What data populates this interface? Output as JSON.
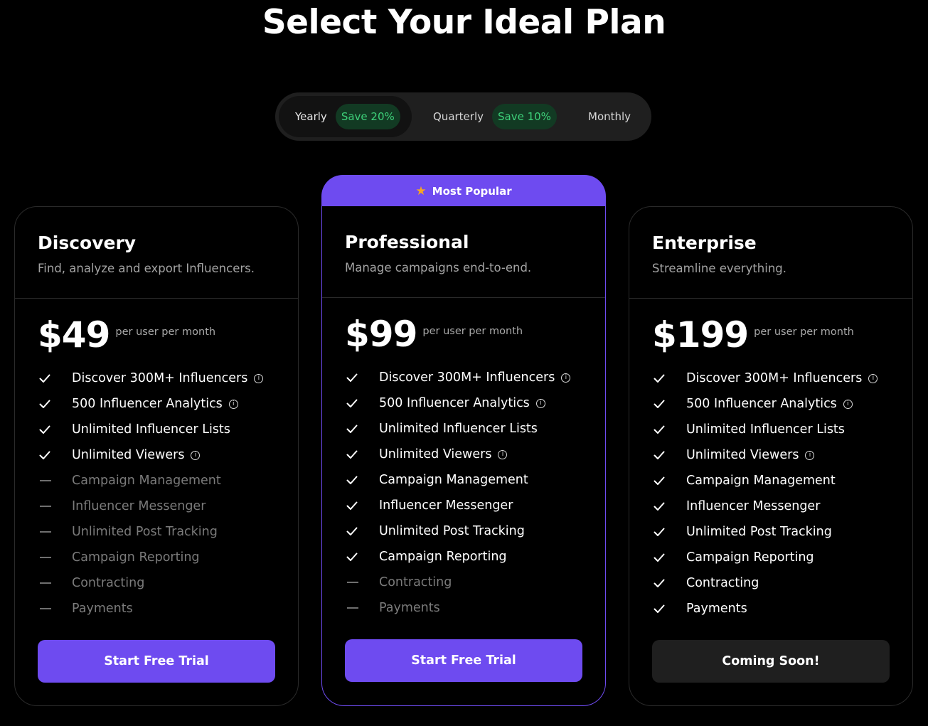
{
  "header": {
    "title": "Select Your Ideal Plan"
  },
  "billing": {
    "yearly_label": "Yearly",
    "yearly_badge": "Save 20%",
    "quarterly_label": "Quarterly",
    "quarterly_badge": "Save 10%",
    "monthly_label": "Monthly",
    "selected": "Yearly"
  },
  "popular_badge": {
    "icon": "star-icon",
    "label": "Most Popular"
  },
  "colors": {
    "accent": "#6e4bf0",
    "save_badge_text": "#3ed17a",
    "star": "#f5a623"
  },
  "plans": [
    {
      "name": "Discovery",
      "description": "Find, analyze and export Influencers.",
      "price": "$49",
      "per": "per user per month",
      "cta": "Start Free Trial",
      "features": [
        {
          "text": "Discover 300M+ Influencers",
          "included": true,
          "info": true
        },
        {
          "text": "500 Influencer Analytics",
          "included": true,
          "info": true
        },
        {
          "text": "Unlimited Influencer Lists",
          "included": true,
          "info": false
        },
        {
          "text": "Unlimited Viewers",
          "included": true,
          "info": true
        },
        {
          "text": "Campaign Management",
          "included": false,
          "info": false
        },
        {
          "text": "Influencer Messenger",
          "included": false,
          "info": false
        },
        {
          "text": "Unlimited Post Tracking",
          "included": false,
          "info": false
        },
        {
          "text": "Campaign Reporting",
          "included": false,
          "info": false
        },
        {
          "text": "Contracting",
          "included": false,
          "info": false
        },
        {
          "text": "Payments",
          "included": false,
          "info": false
        }
      ]
    },
    {
      "name": "Professional",
      "description": "Manage campaigns end-to-end.",
      "price": "$99",
      "per": "per user per month",
      "cta": "Start Free Trial",
      "features": [
        {
          "text": "Discover 300M+ Influencers",
          "included": true,
          "info": true
        },
        {
          "text": "500 Influencer Analytics",
          "included": true,
          "info": true
        },
        {
          "text": "Unlimited Influencer Lists",
          "included": true,
          "info": false
        },
        {
          "text": "Unlimited Viewers",
          "included": true,
          "info": true
        },
        {
          "text": "Campaign Management",
          "included": true,
          "info": false
        },
        {
          "text": "Influencer Messenger",
          "included": true,
          "info": false
        },
        {
          "text": "Unlimited Post Tracking",
          "included": true,
          "info": false
        },
        {
          "text": "Campaign Reporting",
          "included": true,
          "info": false
        },
        {
          "text": "Contracting",
          "included": false,
          "info": false
        },
        {
          "text": "Payments",
          "included": false,
          "info": false
        }
      ]
    },
    {
      "name": "Enterprise",
      "description": "Streamline everything.",
      "price": "$199",
      "per": "per user per month",
      "cta": "Coming Soon!",
      "features": [
        {
          "text": "Discover 300M+ Influencers",
          "included": true,
          "info": true
        },
        {
          "text": "500 Influencer Analytics",
          "included": true,
          "info": true
        },
        {
          "text": "Unlimited Influencer Lists",
          "included": true,
          "info": false
        },
        {
          "text": "Unlimited Viewers",
          "included": true,
          "info": true
        },
        {
          "text": "Campaign Management",
          "included": true,
          "info": false
        },
        {
          "text": "Influencer Messenger",
          "included": true,
          "info": false
        },
        {
          "text": "Unlimited Post Tracking",
          "included": true,
          "info": false
        },
        {
          "text": "Campaign Reporting",
          "included": true,
          "info": false
        },
        {
          "text": "Contracting",
          "included": true,
          "info": false
        },
        {
          "text": "Payments",
          "included": true,
          "info": false
        }
      ]
    }
  ]
}
